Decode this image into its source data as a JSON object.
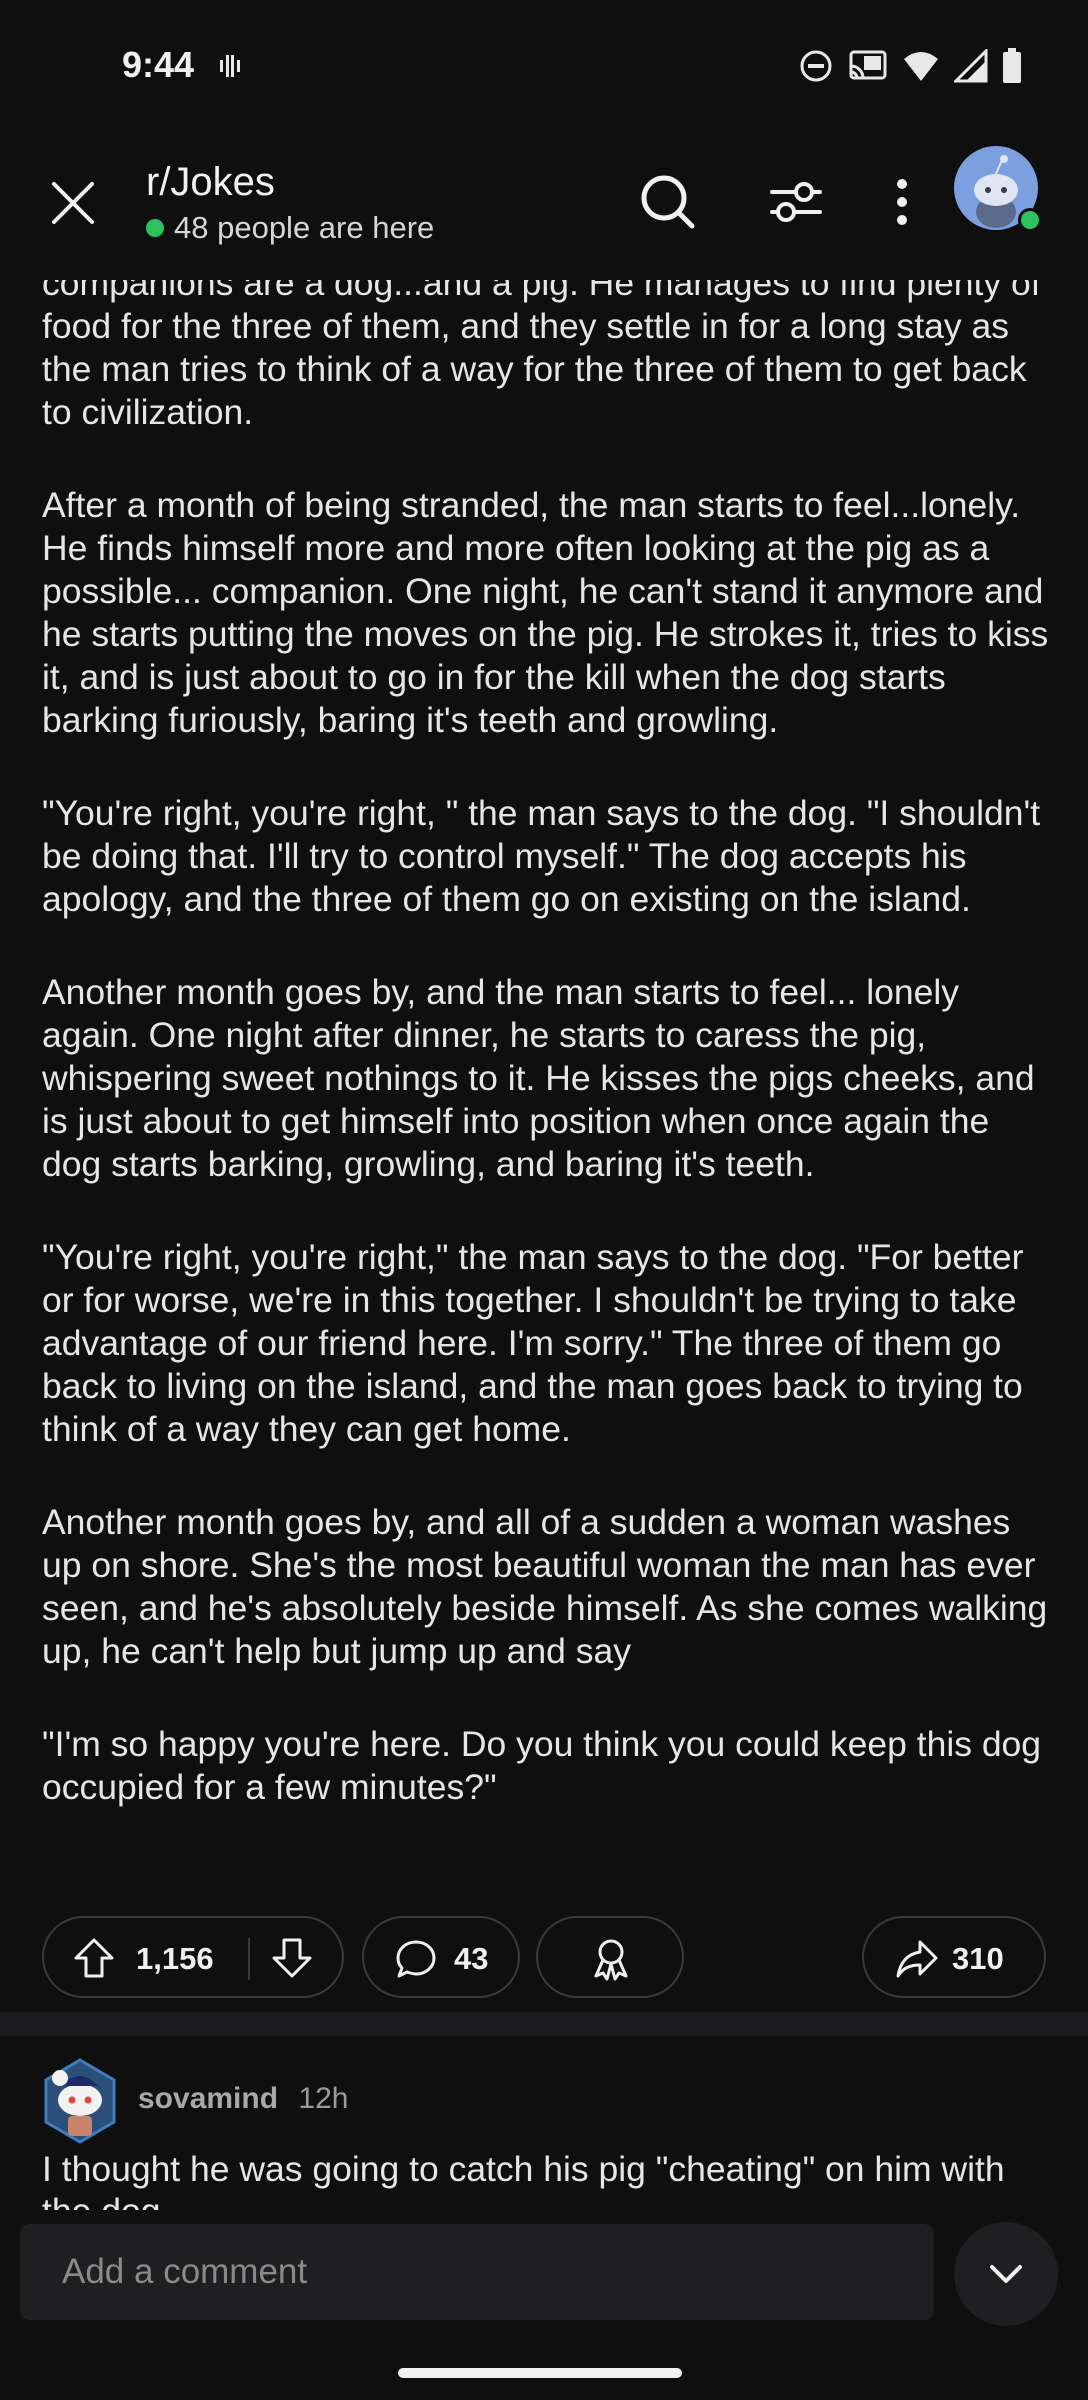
{
  "status_bar": {
    "time": "9:44",
    "icons": [
      "vibrate-icon",
      "do-not-disturb-icon",
      "cast-icon",
      "wifi-icon",
      "signal-icon",
      "battery-icon"
    ]
  },
  "header": {
    "subreddit": "r/Jokes",
    "online_text": "48 people are here",
    "icons": [
      "close-icon",
      "search-icon",
      "filter-icon",
      "more-icon"
    ]
  },
  "post": {
    "paragraphs": [
      "companions are a dog...and a pig. He manages to find plenty of food for the three of them, and they settle in for a long stay as the man tries to think of a way for the three of them to get back to civilization.",
      "After a month of being stranded, the man starts to feel...lonely. He finds himself more and more often looking at the pig as a possible... companion. One night, he can't stand it anymore and he starts putting the moves on the pig. He strokes it, tries to kiss it, and is just about to go in for the kill when the dog starts barking furiously, baring it's teeth and growling.",
      "\"You're right, you're right, \" the man says to the dog. \"I shouldn't be doing that. I'll try to control myself.\" The dog accepts his apology, and the three of them go on existing on the island.",
      "Another month goes by, and the man starts to feel... lonely again. One night after dinner, he starts to caress the pig, whispering sweet nothings to it. He kisses the pigs cheeks, and is just about to get himself into position when once again the dog starts barking, growling, and baring it's teeth.",
      "\"You're right, you're right,\" the man says to the dog. \"For better or for worse, we're in this together. I shouldn't be trying to take advantage of our friend here. I'm sorry.\" The three of them go back to living on the island, and the man goes back to trying to think of a way they can get home.",
      "Another month goes by, and all of a sudden a woman washes up on shore. She's the most beautiful woman the man has ever seen, and he's absolutely beside himself. As she comes walking up, he can't help but jump up and say",
      "\"I'm so happy you're here. Do you think you could keep this dog occupied for a few minutes?\""
    ],
    "actions": {
      "votes": "1,156",
      "comments": "43",
      "shares": "310"
    }
  },
  "comment": {
    "username": "sovamind",
    "age": "12h",
    "text": "I thought he was going to catch his pig \"cheating\" on him with the dog"
  },
  "bottom": {
    "comment_placeholder": "Add a comment"
  },
  "colors": {
    "background": "#0f0f10",
    "online_green": "#2ec25f",
    "pill_border": "#3a3a3c",
    "input_bg": "#1f1f21"
  }
}
